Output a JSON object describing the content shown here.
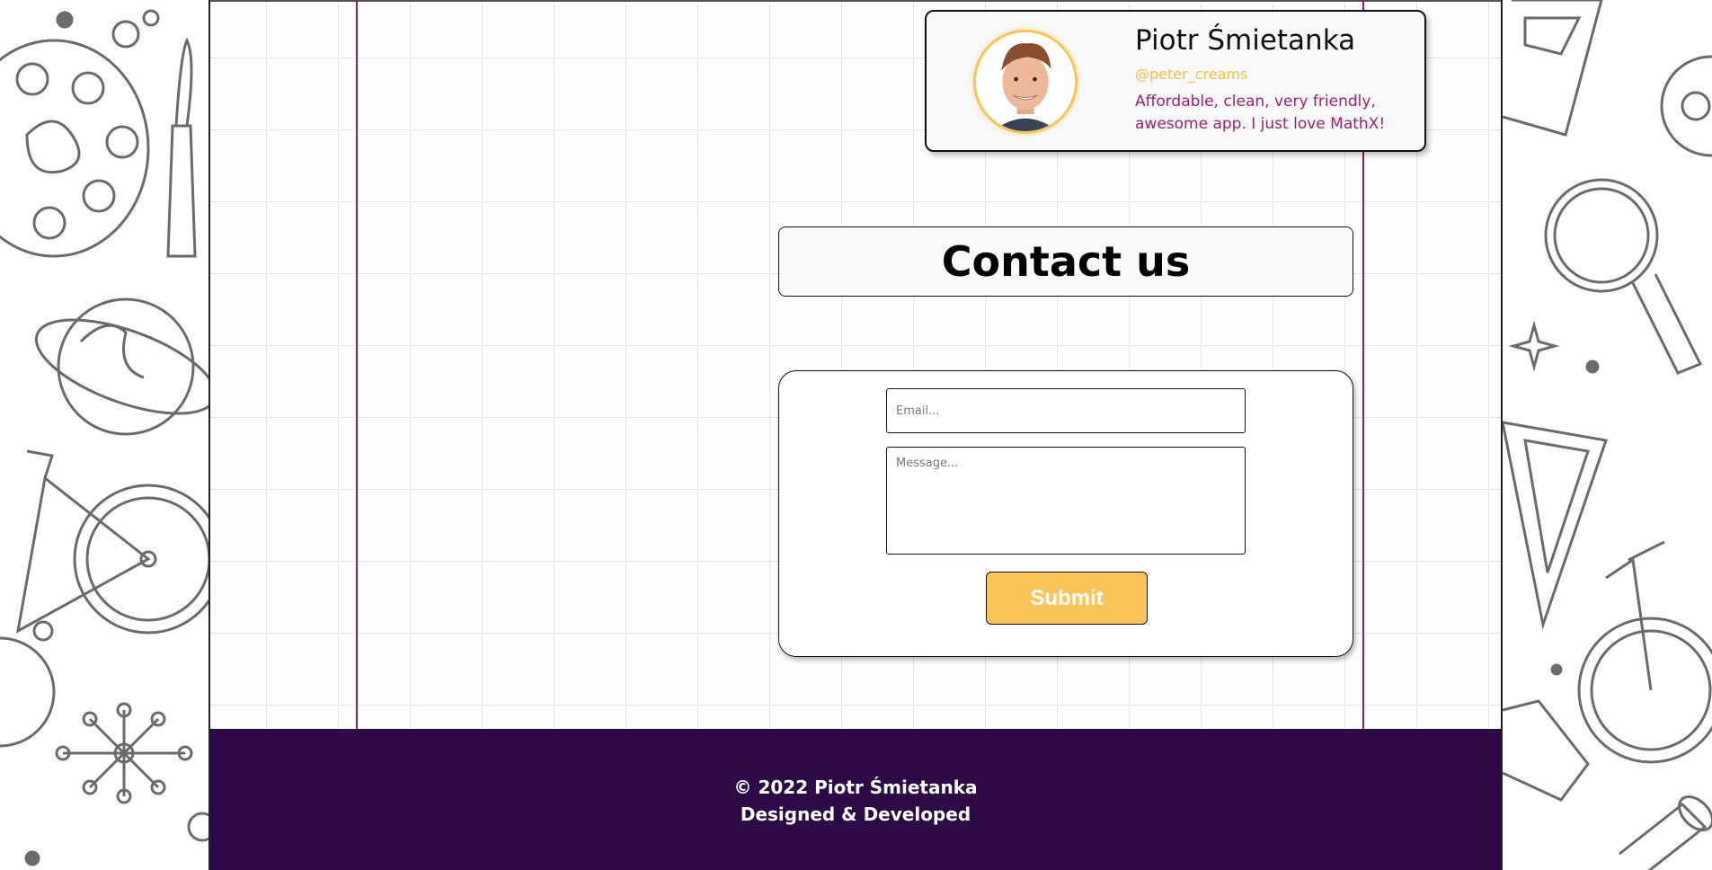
{
  "review": {
    "name": "Piotr Śmietanka",
    "handle": "@peter_creams",
    "text": "Affordable, clean, very friendly, awesome app. I just love MathX!"
  },
  "contact": {
    "title": "Contact us",
    "email_placeholder": "Email...",
    "message_placeholder": "Message...",
    "submit_label": "Submit"
  },
  "footer": {
    "copyright": "© 2022 Piotr Śmietanka",
    "credit": "Designed & Developed"
  },
  "colors": {
    "accent": "#fcc559",
    "handle": "#f7bd4a",
    "review_text": "#9c1f6e",
    "guide_line": "#8e1f6e",
    "footer_bg": "#2d0a45"
  }
}
